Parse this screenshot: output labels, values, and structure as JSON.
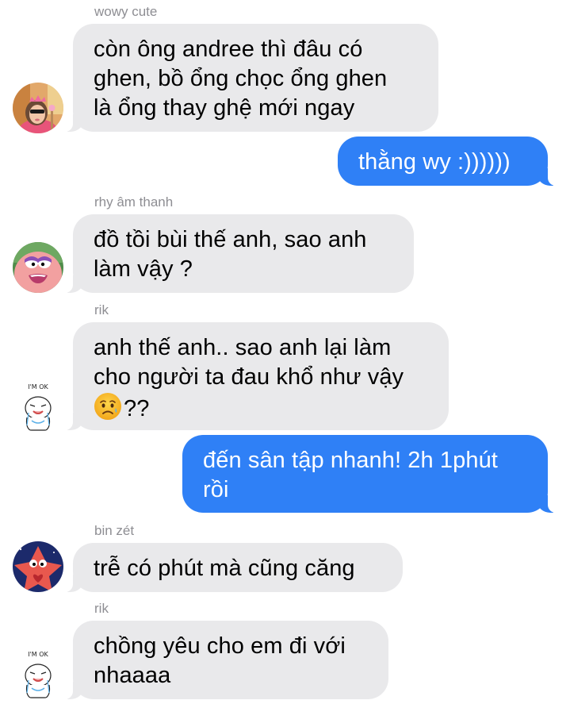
{
  "messages": [
    {
      "sender": "wowy cute",
      "direction": "incoming",
      "lines": [
        "còn ông andree thì đâu có",
        "ghen, bồ ổng chọc ổng ghen",
        "là ổng thay ghệ mới ngay"
      ],
      "avatar": "girl-sunglasses-avatar"
    },
    {
      "direction": "outgoing",
      "lines": [
        "thằng wy :))))))"
      ]
    },
    {
      "sender": "rhy âm thanh",
      "direction": "incoming",
      "lines": [
        "đồ tồi bùi thế anh, sao anh",
        "làm vậy ?"
      ],
      "avatar": "patrick-star-avatar"
    },
    {
      "sender": "rik",
      "direction": "incoming",
      "lines": [
        "anh thế anh.. sao anh lại làm",
        "cho người ta đau khổ như vậy",
        "??"
      ],
      "emoji": "sad-relieved-face-emoji",
      "avatar": "im-ok-sticker-avatar"
    },
    {
      "direction": "outgoing",
      "lines": [
        "đến sân tập nhanh! 2h 1phút",
        "rồi"
      ]
    },
    {
      "sender": "bin zét",
      "direction": "incoming",
      "lines": [
        "trễ có phút mà cũng căng"
      ],
      "avatar": "patrick-star-heart-avatar"
    },
    {
      "sender": "rik",
      "direction": "incoming",
      "lines": [
        "chồng yêu cho em đi với",
        "nhaaaa"
      ],
      "avatar": "im-ok-sticker-avatar"
    }
  ],
  "avatar_text": {
    "im_ok": "I'M  OK"
  },
  "colors": {
    "incoming_bubble": "#e9e9eb",
    "outgoing_bubble": "#2f80f6",
    "sender_label": "#8e8e93"
  }
}
